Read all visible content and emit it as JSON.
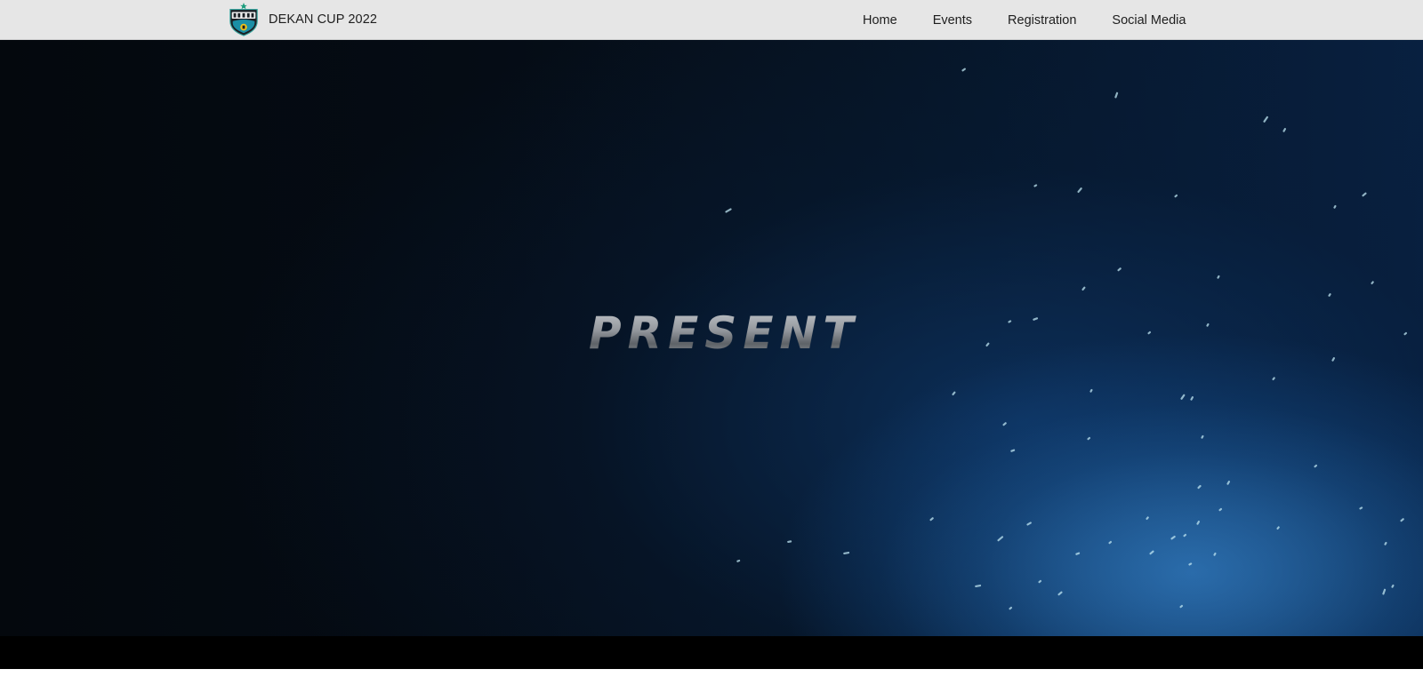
{
  "navbar": {
    "brand_text": "DEKAN CUP 2022",
    "logo_icon": "dekan-shield-logo",
    "links": [
      "Home",
      "Events",
      "Registration",
      "Social Media"
    ]
  },
  "hero": {
    "word": "PRESENT"
  },
  "colors": {
    "navbar_bg": "#e6e6e6",
    "nav_text": "#1e1e1e",
    "hero_dark": "#04080d",
    "hero_blue": "#286eb4",
    "particle": "#bfe6f2"
  }
}
